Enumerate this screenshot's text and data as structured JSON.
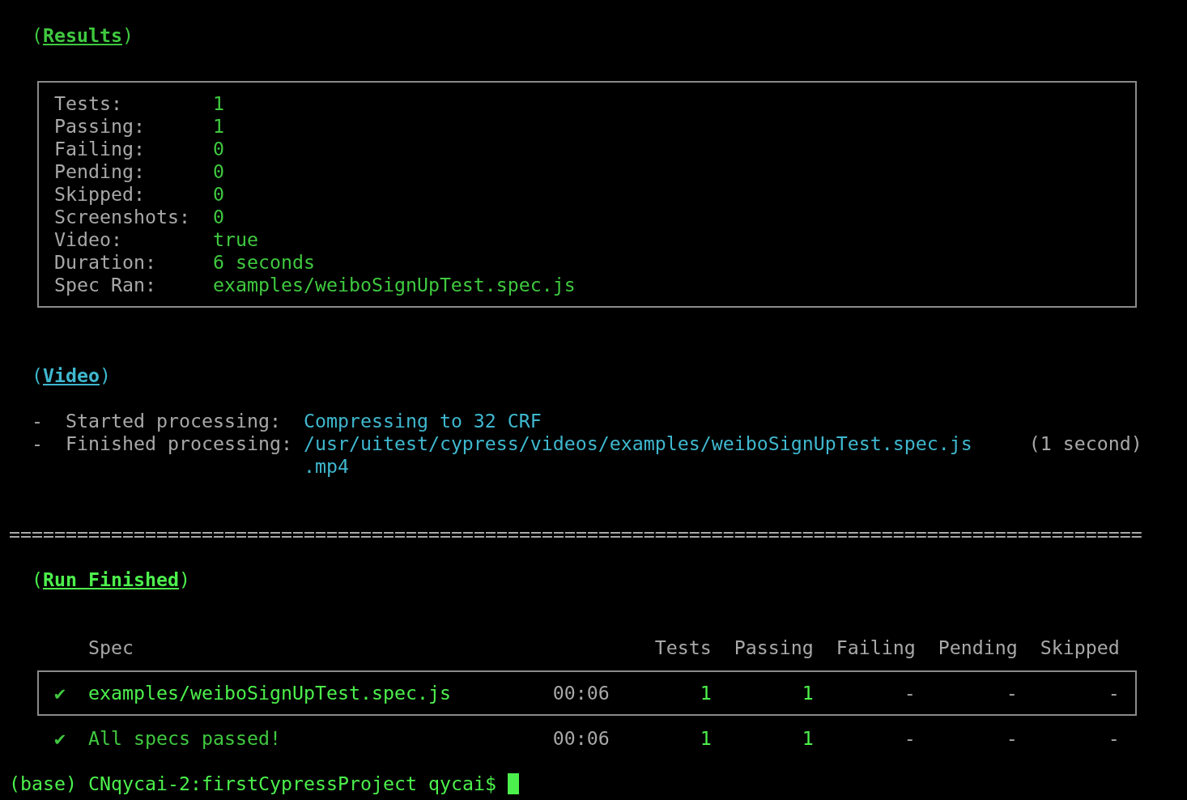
{
  "results": {
    "heading": "(**Results**)",
    "color": "#3fc93f",
    "rows": [
      {
        "label": "Tests:",
        "value": "1"
      },
      {
        "label": "Passing:",
        "value": "1"
      },
      {
        "label": "Failing:",
        "value": "0"
      },
      {
        "label": "Pending:",
        "value": "0"
      },
      {
        "label": "Skipped:",
        "value": "0"
      },
      {
        "label": "Screenshots:",
        "value": "0"
      },
      {
        "label": "Video:",
        "value": "true"
      },
      {
        "label": "Duration:",
        "value": "6 seconds"
      },
      {
        "label": "Spec Ran:",
        "value": "examples/weiboSignUpTest.spec.js"
      }
    ]
  },
  "video": {
    "heading": "(**Video**)",
    "color": "#3fb8cf",
    "lines": [
      {
        "bullet": "-",
        "label": "Started processing:",
        "value": "Compressing to 32 CRF"
      },
      {
        "bullet": "-",
        "label": "Finished processing:",
        "value": "/usr/uitest/cypress/videos/examples/weiboSignUpTest.spec.js",
        "note": "(1 second)",
        "continuation": ".mp4"
      }
    ]
  },
  "separator": "====================================================================================================",
  "run_finished": {
    "heading": "(**Run Finished**)",
    "color": "#4cf04c",
    "columns": [
      "Spec",
      "Tests",
      "Passing",
      "Failing",
      "Pending",
      "Skipped"
    ],
    "rows": [
      {
        "boxed": true,
        "mark": "✔",
        "spec": "examples/weiboSignUpTest.spec.js",
        "time": "00:06",
        "tests": "1",
        "passing": "1",
        "failing": "-",
        "pending": "-",
        "skipped": "-"
      },
      {
        "boxed": false,
        "mark": "✔",
        "spec": "All specs passed!",
        "time": "00:06",
        "tests": "1",
        "passing": "1",
        "failing": "-",
        "pending": "-",
        "skipped": "-"
      }
    ]
  },
  "prompt": {
    "text": "(base) CNqycai-2:firstCypressProject qycai$",
    "cursor": true
  }
}
